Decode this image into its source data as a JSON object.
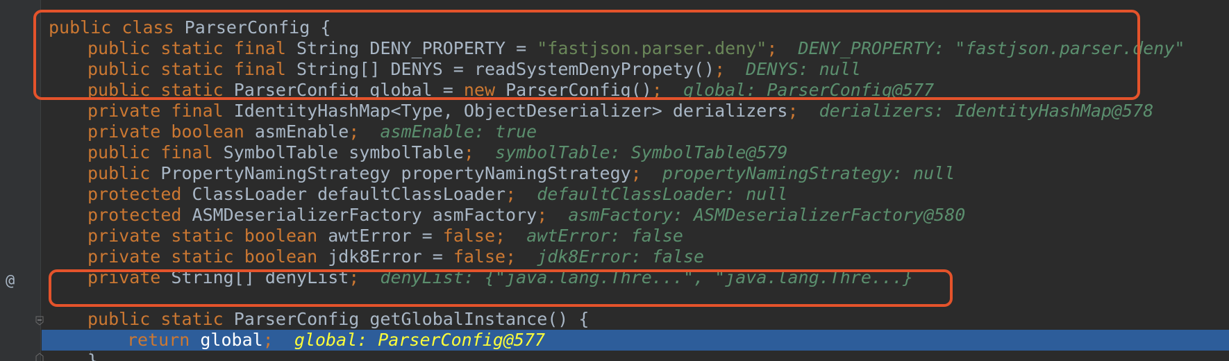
{
  "colors": {
    "background": "#2b2b2b",
    "keyword": "#cc7832",
    "string": "#6a8759",
    "identifier": "#a9b7c6",
    "inlay_hint": "#5b8f6e",
    "highlight_bg": "#2d5d9a",
    "highlight_hint": "#fdfd3a",
    "annotation_border": "#e4532b"
  },
  "gutter": {
    "override_marker": "@",
    "fold_icon": "fold-minus-icon"
  },
  "lines": [
    {
      "kw1": "public class ",
      "id1": "ParserConfig {"
    },
    {
      "kw1": "public static final ",
      "id1": "String DENY_PROPERTY = ",
      "str": "\"fastjson.parser.deny\"",
      "kw2": ";",
      "hint": "DENY_PROPERTY: \"fastjson.parser.deny\""
    },
    {
      "kw1": "public static final ",
      "id1": "String[] DENYS = readSystemDenyPropety()",
      "kw2": ";",
      "hint": "DENYS: null"
    },
    {
      "kw1": "public static ",
      "id1": "ParserConfig global = ",
      "kw2": "new ",
      "id2": "ParserConfig()",
      "kw3": ";",
      "hint": "global: ParserConfig@577"
    },
    {
      "kw1": "private final ",
      "id1": "IdentityHashMap<Type, ObjectDeserializer> derializers",
      "kw2": ";",
      "hint": "derializers: IdentityHashMap@578"
    },
    {
      "kw1": "private boolean ",
      "id1": "asmEnable",
      "kw2": ";",
      "hint": "asmEnable: true"
    },
    {
      "kw1": "public final ",
      "id1": "SymbolTable symbolTable",
      "kw2": ";",
      "hint": "symbolTable: SymbolTable@579"
    },
    {
      "kw1": "public ",
      "id1": "PropertyNamingStrategy propertyNamingStrategy",
      "kw2": ";",
      "hint": "propertyNamingStrategy: null"
    },
    {
      "kw1": "protected ",
      "id1": "ClassLoader defaultClassLoader",
      "kw2": ";",
      "hint": "defaultClassLoader: null"
    },
    {
      "kw1": "protected ",
      "id1": "ASMDeserializerFactory asmFactory",
      "kw2": ";",
      "hint": "asmFactory: ASMDeserializerFactory@580"
    },
    {
      "kw1": "private static boolean ",
      "id1": "awtError = ",
      "kw2": "false;",
      "hint": "awtError: false"
    },
    {
      "kw1": "private static boolean ",
      "id1": "jdk8Error = ",
      "kw2": "false;",
      "hint": "jdk8Error: false"
    },
    {
      "kw1": "private ",
      "id1": "String[] denyList",
      "kw2": ";",
      "hint": "denyList: {\"java.lang.Thre...\", \"java.lang.Thre...}"
    },
    {
      "kw1": "public static ",
      "id1": "ParserConfig getGlobalInstance() {"
    },
    {
      "kw1": "return ",
      "id1": "global",
      "kw2": ";",
      "hint": "global: ParserConfig@577"
    },
    {
      "id1": "}"
    }
  ]
}
